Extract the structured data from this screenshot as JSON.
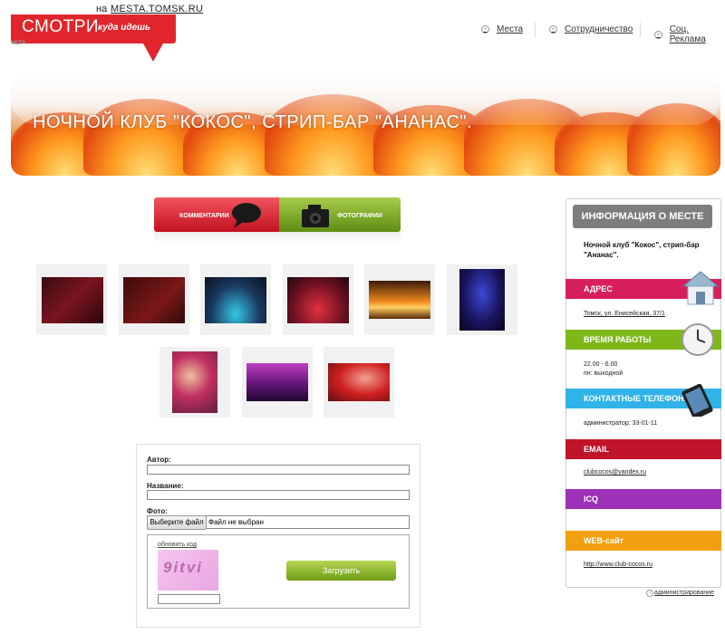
{
  "logo": {
    "main": "СМОТРИ",
    "sub": "куда идешь",
    "prefix": "на",
    "site": "MESTA.TOMSK.RU",
    "meta": "META"
  },
  "nav": {
    "items": [
      {
        "label": "Места"
      },
      {
        "label": "Сотрудничество"
      },
      {
        "label": "Соц. Реклама"
      }
    ]
  },
  "banner": {
    "title": "НОЧНОЙ КЛУБ \"КОКОС\", СТРИП-БАР \"АНАНАС\"."
  },
  "tabs": {
    "comments": "КОММЕНТАРИИ",
    "photos": "ФОТОГРАФИИ"
  },
  "form": {
    "author_label": "Автор:",
    "title_label": "Название:",
    "photo_label": "Фото:",
    "file_button": "Выберите файл",
    "file_status": "Файл не выбран",
    "captcha_refresh": "обновить код",
    "captcha_text": "9itvi",
    "submit": "Загрузить"
  },
  "sidebar": {
    "header": "ИНФОРМАЦИЯ О МЕСТЕ",
    "place_name": "Ночной клуб \"Кокос\", стрип-бар \"Ананас\".",
    "sections": {
      "address": {
        "title": "АДРЕС",
        "color": "#d81f5d",
        "value": "Томск, ул. Енисейская, 37/1"
      },
      "hours": {
        "title": "ВРЕМЯ РАБОТЫ",
        "color": "#7fb71a",
        "value1": "22.00 - 6.00",
        "value2": "пн: выходной"
      },
      "phones": {
        "title": "КОНТАКТНЫЕ ТЕЛЕФОНЫ",
        "color": "#30b3e8",
        "value": "администратор: 33-01-11"
      },
      "email": {
        "title": "EMAIL",
        "color": "#c0142a",
        "value": "clubcocos@yandex.ru"
      },
      "icq": {
        "title": "ICQ",
        "color": "#9d31b8",
        "value": ""
      },
      "web": {
        "title": "WEB-сайт",
        "color": "#f2a010",
        "value": "http://www.club-cocos.ru"
      }
    },
    "admin": "администрирование"
  },
  "colors": {
    "brand_red": "#e0262c",
    "tab_red": "#d62531",
    "tab_green": "#7dac2a",
    "submit_green": "#8ab82c"
  }
}
